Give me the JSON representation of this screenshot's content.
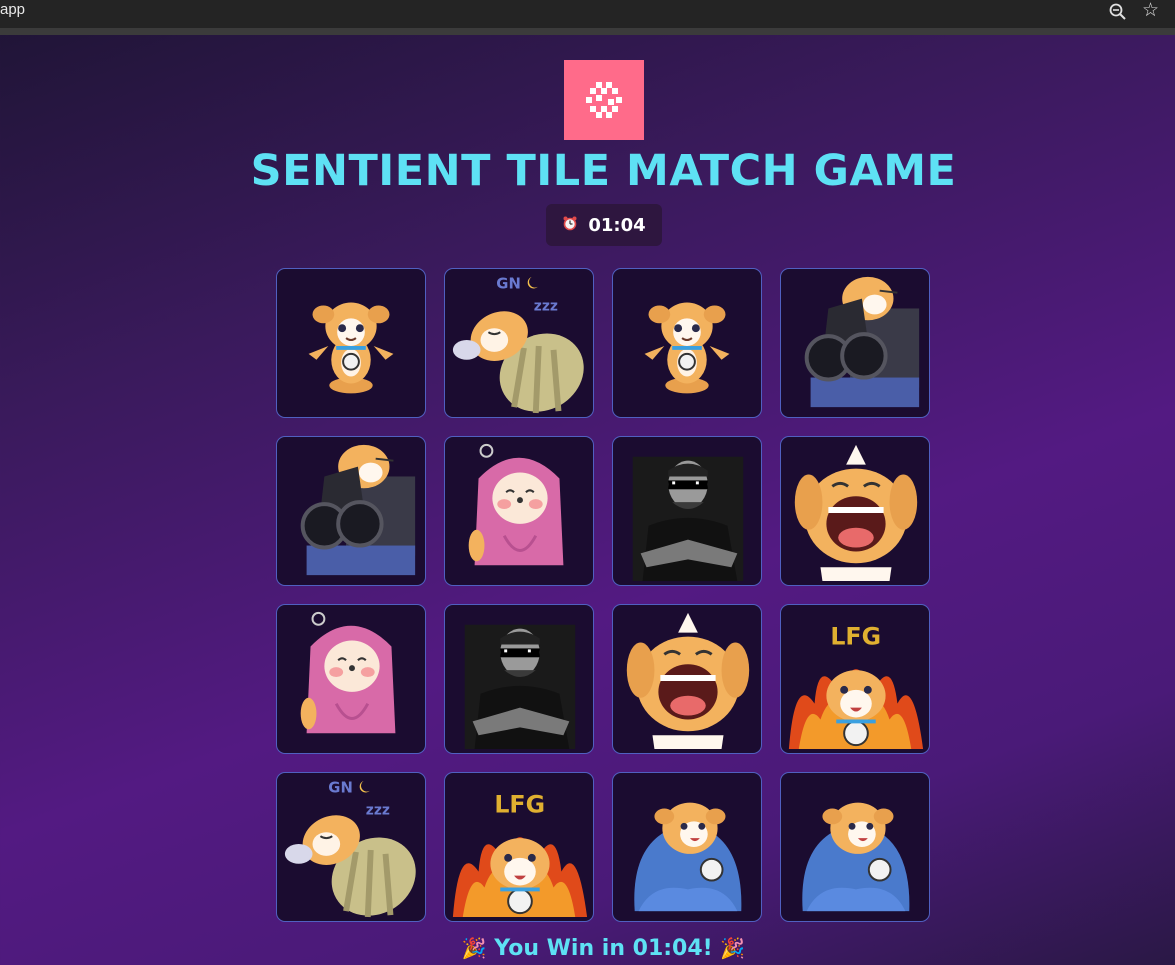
{
  "browser": {
    "url_fragment": "app",
    "zoom_icon": "zoom-out-icon",
    "bookmark_icon": "star-icon"
  },
  "game": {
    "logo_icon": "sentient-logo-icon",
    "title": "SENTIENT TILE MATCH GAME",
    "timer_icon": "alarm-clock-icon",
    "timer_value": "01:04",
    "win_message": "You Win in 01:04!",
    "win_icon": "party-popper-icon"
  },
  "colors": {
    "accent_cyan": "#5ee1f4",
    "logo_pink": "#ff6b8a",
    "tile_border": "#5060c0",
    "tile_bg": "#1b0c30"
  },
  "board": {
    "rows": 4,
    "cols": 4,
    "tiles": [
      "dog-shrug",
      "dog-sleeping-gn",
      "dog-shrug",
      "dog-shotgun",
      "dog-shotgun",
      "dog-hijab",
      "man-sunglasses",
      "dog-laughing",
      "dog-hijab",
      "man-sunglasses",
      "dog-laughing",
      "dog-lfg-fire",
      "dog-sleeping-gn",
      "dog-lfg-fire",
      "dog-blanket",
      "dog-blanket"
    ]
  }
}
